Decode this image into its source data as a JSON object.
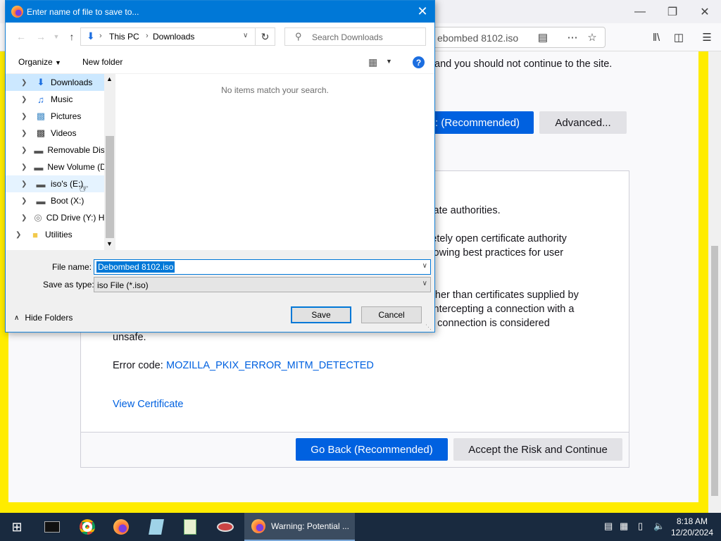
{
  "dialog": {
    "title": "Enter name of file to save to...",
    "breadcrumb": [
      "This PC",
      "Downloads"
    ],
    "search_placeholder": "Search Downloads",
    "toolbar": {
      "organize_label": "Organize",
      "new_folder_label": "New folder"
    },
    "nav_items": [
      {
        "label": "Downloads",
        "icon": "download-arrow-icon",
        "state": "selected"
      },
      {
        "label": "Music",
        "icon": "music-note-icon",
        "state": ""
      },
      {
        "label": "Pictures",
        "icon": "pictures-icon",
        "state": ""
      },
      {
        "label": "Videos",
        "icon": "film-icon",
        "state": ""
      },
      {
        "label": "Removable Dis",
        "icon": "drive-icon",
        "state": ""
      },
      {
        "label": "New Volume (D",
        "icon": "drive-icon",
        "state": ""
      },
      {
        "label": "iso's (E:)",
        "icon": "drive-icon",
        "state": "hover"
      },
      {
        "label": "Boot (X:)",
        "icon": "drive-icon",
        "state": ""
      },
      {
        "label": "CD Drive (Y:) H",
        "icon": "cd-drive-icon",
        "state": ""
      },
      {
        "label": "Utilities",
        "icon": "folder-icon",
        "state": ""
      }
    ],
    "empty_message": "No items match your search.",
    "file_name_label": "File name:",
    "file_name_value": "Debombed 8102.iso",
    "save_as_type_label": "Save as type:",
    "save_as_type_value": "iso File (*.iso)",
    "save_label": "Save",
    "cancel_label": "Cancel",
    "hide_folders_label": "Hide Folders",
    "accent_color": "#0078d7"
  },
  "browser": {
    "url_partial": "ebombed 8102.iso",
    "line_warning": "and you should not continue to the site.",
    "recommended_partial": ": (Recommended)",
    "advanced_label": "Advanced...",
    "panel_lines": [
      "ficate authorities.",
      "oletely open certificate authority",
      "ollowing best practices for user",
      "rather than certificates supplied by",
      "s intercepting a connection with a",
      "he connection is considered",
      "unsafe."
    ],
    "error_code_label": "Error code:",
    "error_code": "MOZILLA_PKIX_ERROR_MITM_DETECTED",
    "view_certificate": "View Certificate",
    "go_back_label": "Go Back (Recommended)",
    "accept_label": "Accept the Risk and Continue",
    "frame_color": "#ffec00",
    "button_color": "#0061e0"
  },
  "taskbar": {
    "active_window": "Warning: Potential ...",
    "time": "8:18 AM",
    "date": "12/20/2024"
  }
}
